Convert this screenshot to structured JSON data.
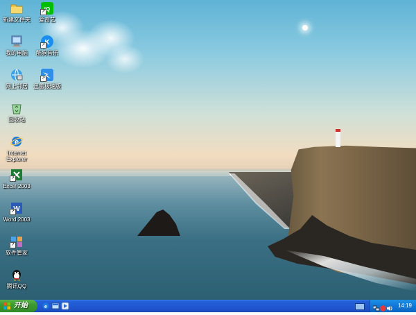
{
  "desktop": {
    "icons": [
      {
        "id": "new-folder",
        "label": "新建文件夹",
        "icon": "folder-icon"
      },
      {
        "id": "iqiyi",
        "label": "爱奇艺",
        "icon": "iqiyi-icon"
      },
      {
        "id": "my-computer",
        "label": "我的电脑",
        "icon": "computer-icon"
      },
      {
        "id": "kugou",
        "label": "酷狗音乐",
        "icon": "kugou-icon"
      },
      {
        "id": "network",
        "label": "网上邻居",
        "icon": "network-icon"
      },
      {
        "id": "xunlei",
        "label": "迅雷极速版",
        "icon": "xunlei-icon"
      },
      {
        "id": "recycle-bin",
        "label": "回收站",
        "icon": "recycle-bin-icon"
      },
      {
        "id": "ie",
        "label": "Internet\nExplorer",
        "icon": "ie-icon"
      },
      {
        "id": "excel",
        "label": "Excel 2003",
        "icon": "excel-icon"
      },
      {
        "id": "word",
        "label": "Word 2003",
        "icon": "word-icon"
      },
      {
        "id": "software-manager",
        "label": "软件管家",
        "icon": "software-manager-icon"
      },
      {
        "id": "qq",
        "label": "腾讯QQ",
        "icon": "qq-icon"
      }
    ]
  },
  "taskbar": {
    "start_label": "开始",
    "quick_launch": [
      "ie-icon",
      "show-desktop-icon",
      "media-icon"
    ],
    "tray_icons": [
      "network-tray-icon",
      "security-tray-icon",
      "sound-tray-icon"
    ],
    "clock": "14:19"
  },
  "colors": {
    "taskbar": "#2157d3",
    "start_button": "#3c9a2f",
    "tray": "#0f78d8"
  }
}
